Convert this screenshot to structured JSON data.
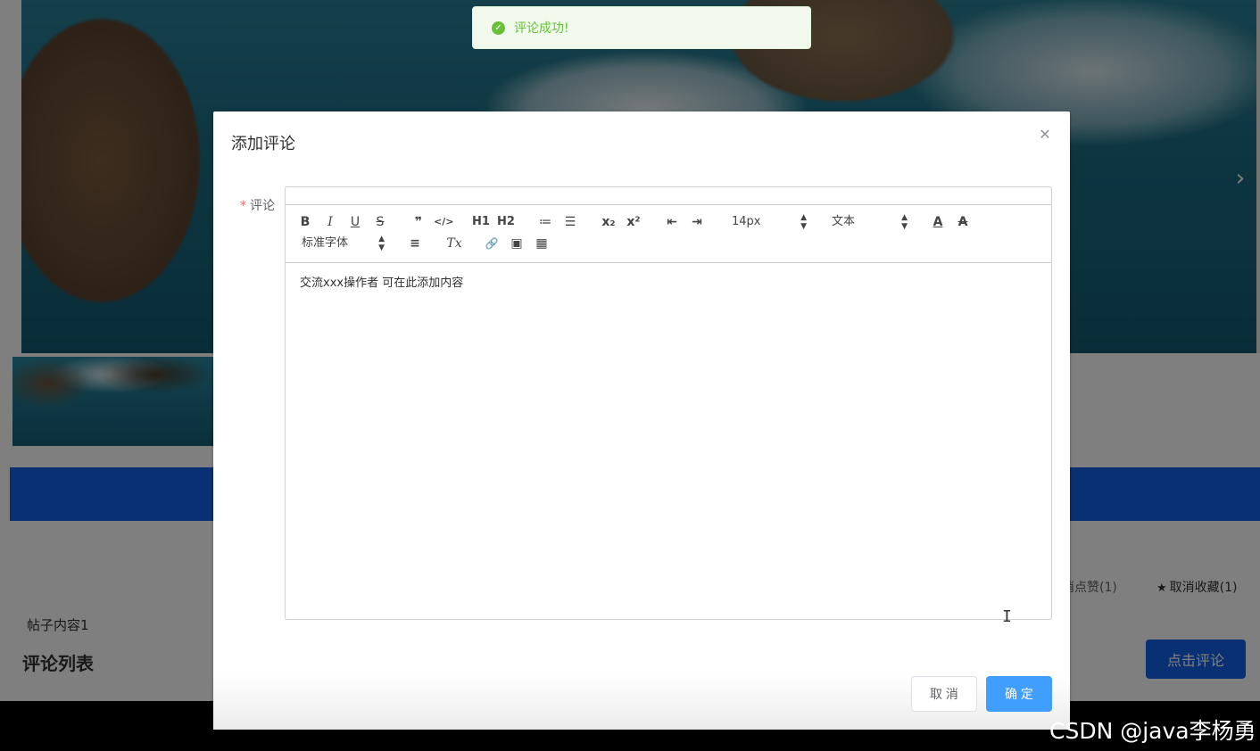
{
  "background": {
    "post_content": "帖子内容1",
    "comment_list_title": "评论列表",
    "like_label": "消点赞(1)",
    "favorite_label": "取消收藏(1)",
    "comment_button": "点击评论",
    "carousel_next_icon": "chevron-right-icon",
    "watermark": "CSDN @java李杨勇"
  },
  "toast": {
    "message": "评论成功!",
    "icon": "success-check-icon",
    "color": "#67c23a"
  },
  "dialog": {
    "title": "添加评论",
    "close_icon": "close-icon",
    "field_label": "评论",
    "required_mark": "*",
    "editor": {
      "toolbar": {
        "bold": "B",
        "italic": "I",
        "underline": "U",
        "strike": "S",
        "blockquote": "❞",
        "code_block": "</>",
        "h1": "H1",
        "h2": "H2",
        "ordered_list": "≔",
        "bullet_list": "☰",
        "subscript": "x₂",
        "superscript": "x²",
        "outdent": "⇤",
        "indent": "⇥",
        "font_size": "14px",
        "header_select": "文本",
        "text_color": "A",
        "background_color": "A",
        "font_family": "标准字体",
        "align": "≡",
        "clean": "Tx",
        "link": "🔗",
        "image": "▣",
        "video": "▦"
      },
      "content": "交流xxx操作者 可在此添加内容"
    },
    "cancel_button": "取 消",
    "confirm_button": "确 定",
    "accent_color": "#409eff"
  }
}
